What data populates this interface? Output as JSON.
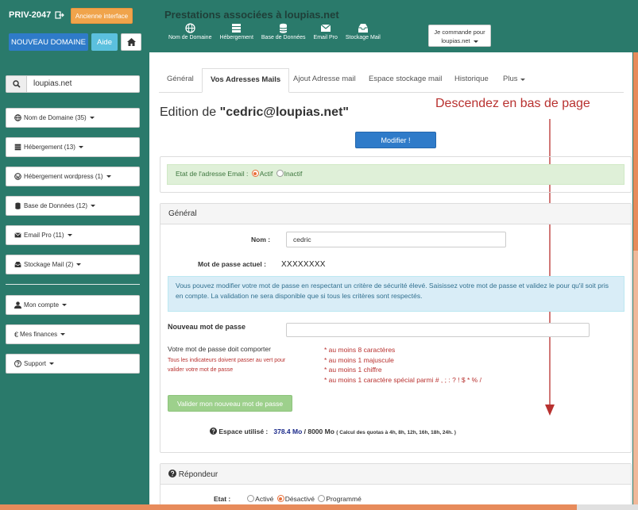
{
  "header": {
    "priv": "PRIV-2047",
    "ancienne_interface": "Ancienne interface",
    "nouveau_domaine": "NOUVEAU DOMAINE",
    "aide": "Aide",
    "title": "Prestations associées à loupias.net",
    "nav": [
      {
        "label": "Nom de Domaine",
        "icon": "globe-icon"
      },
      {
        "label": "Hébergement",
        "icon": "server-icon"
      },
      {
        "label": "Base de Données",
        "icon": "database-icon"
      },
      {
        "label": "Email Pro",
        "icon": "envelope-icon"
      },
      {
        "label": "Stockage Mail",
        "icon": "inbox-icon"
      }
    ],
    "commande_line1": "Je commande pour",
    "commande_line2": "loupias.net"
  },
  "sidebar": {
    "search_value": "loupias.net",
    "items": [
      {
        "label": "Nom de Domaine (35)",
        "icon": "globe-icon"
      },
      {
        "label": "Hébergement (13)",
        "icon": "server-icon"
      },
      {
        "label": "Hébergement wordpress (1)",
        "icon": "wordpress-icon"
      },
      {
        "label": "Base de Données (12)",
        "icon": "database-icon"
      },
      {
        "label": "Email Pro (11)",
        "icon": "envelope-icon"
      },
      {
        "label": "Stockage Mail (2)",
        "icon": "inbox-icon"
      },
      {
        "label": "Mon compte",
        "icon": "user-icon"
      },
      {
        "label": "Mes finances",
        "icon": "euro-icon"
      },
      {
        "label": "Support",
        "icon": "question-icon"
      }
    ]
  },
  "tabs": [
    "Général",
    "Vos Adresses Mails",
    "Ajout Adresse mail",
    "Espace stockage mail",
    "Historique",
    "Plus"
  ],
  "edit": {
    "prefix": "Edition de ",
    "address": "\"cedric@loupias.net\"",
    "modifier": "Modifier !",
    "annotation": "Descendez en bas de page"
  },
  "etat": {
    "label": "Etat de l'adresse Email :",
    "actif": "Actif",
    "inactif": "Inactif"
  },
  "general": {
    "title": "Général",
    "nom_label": "Nom :",
    "nom_value": "cedric",
    "mdp_actuel_label": "Mot de passe actuel :",
    "mdp_actuel_value": "XXXXXXXX",
    "info": "Vous pouvez modifier votre mot de passe en respectant un critère de sécurité élevé. Saisissez votre mot de passe et validez le pour qu'il soit pris en compte. La validation ne sera disponible que si tous les critères sont respectés.",
    "nouveau_label": "Nouveau mot de passe",
    "doit_comporter": "Votre mot de passe doit comporter",
    "indicateurs_1": "Tous les indicateurs doivent passer au vert pour",
    "indicateurs_2": "valider votre mot de passe",
    "criteres": [
      "* au moins 8 caractères",
      "* au moins 1 majuscule",
      "* au moins 1 chiffre",
      "* au moins 1 caractère spécial parmi # , ; : ? ! $ * % /"
    ],
    "valider": "Valider mon nouveau mot de passe",
    "espace_label": "Espace utilisé :",
    "espace_used": "378.4 Mo",
    "espace_total": " / 8000 Mo",
    "espace_note": "( Calcul des quotas à 4h, 8h, 12h, 16h, 18h, 24h. )"
  },
  "repondeur": {
    "title": "Répondeur",
    "etat_label": "Etat :",
    "activ": "Activé",
    "desactiv": "Désactivé",
    "programme": "Programmé"
  },
  "colors": {
    "frame": "#2a7a6b",
    "primary": "#2f7bc9",
    "orange": "#f0a44b",
    "annotation": "#b8312f"
  }
}
